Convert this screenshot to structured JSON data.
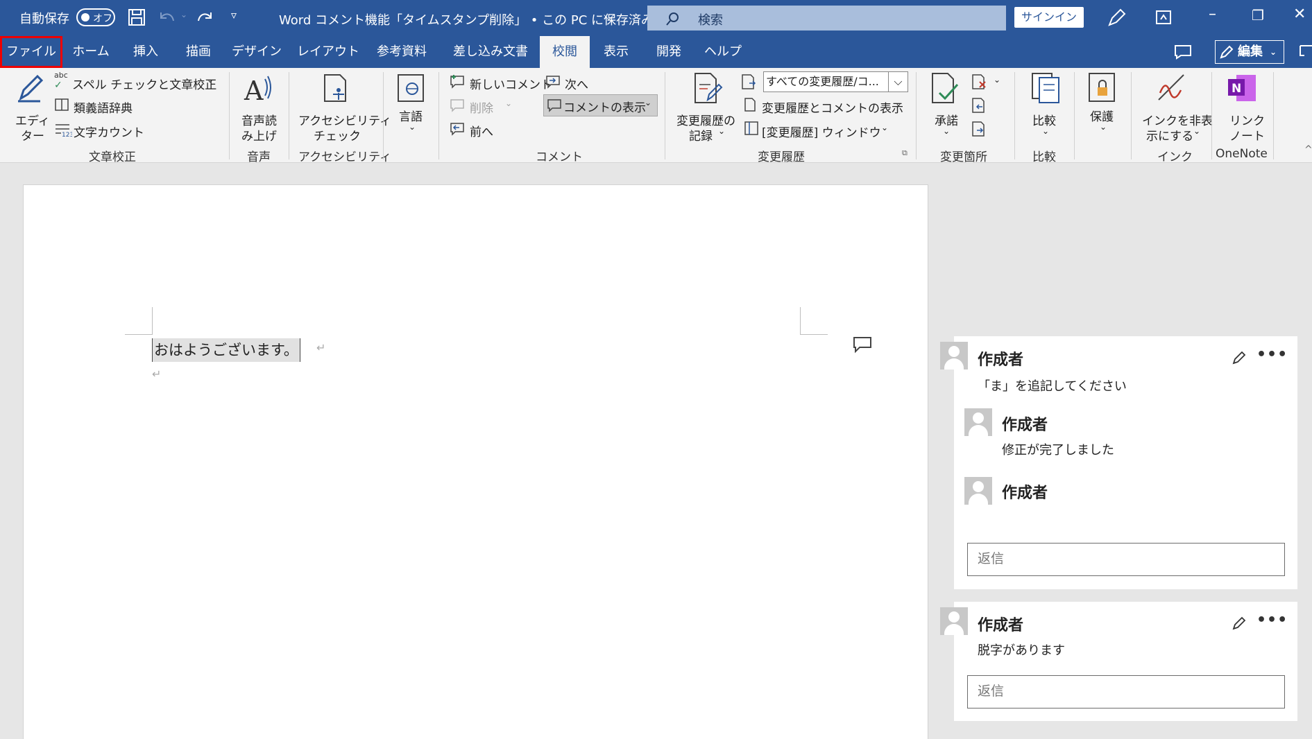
{
  "titlebar": {
    "autosave_label": "自動保存",
    "autosave_state": "オフ",
    "document_title": "Word コメント機能「タイムスタンプ削除」 • この PC に保存済み",
    "search_placeholder": "検索",
    "signin_label": "サインイン"
  },
  "tabs": [
    "ファイル",
    "ホーム",
    "挿入",
    "描画",
    "デザイン",
    "レイアウト",
    "参考資料",
    "差し込み文書",
    "校閲",
    "表示",
    "開発",
    "ヘルプ"
  ],
  "active_tab": "校閲",
  "edit_mode_label": "編集",
  "ribbon": {
    "proofing": {
      "editor_line1": "エディ",
      "editor_line2": "ター",
      "spell": "スペル チェックと文章校正",
      "thesaurus": "類義語辞典",
      "wordcount": "文字カウント",
      "group": "文章校正"
    },
    "speech": {
      "line1": "音声読",
      "line2": "み上げ",
      "group": "音声"
    },
    "accessibility": {
      "line1": "アクセシビリティ",
      "line2": "チェック",
      "group": "アクセシビリティ"
    },
    "language": {
      "label": "言語"
    },
    "comments": {
      "new": "新しいコメント",
      "delete": "削除",
      "prev": "前へ",
      "next": "次へ",
      "show": "コメントの表示",
      "group": "コメント"
    },
    "tracking": {
      "record_line1": "変更履歴の",
      "record_line2": "記録",
      "markup_dropdown": "すべての変更履歴/コ...",
      "show_markup": "変更履歴とコメントの表示",
      "pane": "[変更履歴] ウィンドウ",
      "group": "変更履歴"
    },
    "changes": {
      "accept": "承諾",
      "group": "変更箇所"
    },
    "compare": {
      "label": "比較",
      "group": "比較"
    },
    "protect": {
      "label": "保護"
    },
    "ink": {
      "line1": "インクを非表",
      "line2": "示にする",
      "group": "インク"
    },
    "onenote": {
      "line1": "リンク",
      "line2": "ノート",
      "group": "OneNote"
    }
  },
  "document": {
    "text": "おはようございます。"
  },
  "comments": [
    {
      "author": "作成者",
      "text": "「ま」を追記してください",
      "replies": [
        {
          "author": "作成者",
          "text": "修正が完了しました"
        },
        {
          "author": "作成者",
          "text": ""
        }
      ],
      "reply_placeholder": "返信"
    },
    {
      "author": "作成者",
      "text": "脱字があります",
      "replies": [],
      "reply_placeholder": "返信"
    }
  ]
}
